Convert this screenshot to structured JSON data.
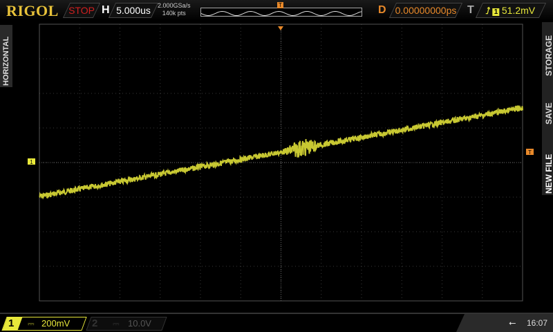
{
  "header": {
    "brand": "RIGOL",
    "run_state": "STOP",
    "horizontal_label": "H",
    "timebase": "5.000us",
    "sample_rate": "2.000GSa/s",
    "memory_depth": "140k pts",
    "delay_label": "D",
    "delay": "0.00000000ps",
    "trigger_label": "T",
    "trigger_edge_icon": "rising-edge-icon",
    "trigger_source": "1",
    "trigger_level": "51.2mV"
  },
  "left_menu": {
    "label": "HORIZONTAL"
  },
  "right_menu": {
    "items": [
      "STORAGE",
      "SAVE",
      "NEW FILE"
    ]
  },
  "markers": {
    "trigger_pos": "T",
    "ch1_ground": "1",
    "trigger_level": "T"
  },
  "footer": {
    "ch1": {
      "number": "1",
      "coupling": "⎓",
      "scale": "200mV",
      "color": "#e8e83a"
    },
    "ch2": {
      "number": "2",
      "coupling": "⎓",
      "scale": "10.0V"
    },
    "usb_icon": "usb-icon",
    "time": "16:07"
  },
  "colors": {
    "ch1": "#d4d43a",
    "trigger": "#e8892a",
    "brand": "#e8c23a",
    "stop": "#d02020"
  }
}
